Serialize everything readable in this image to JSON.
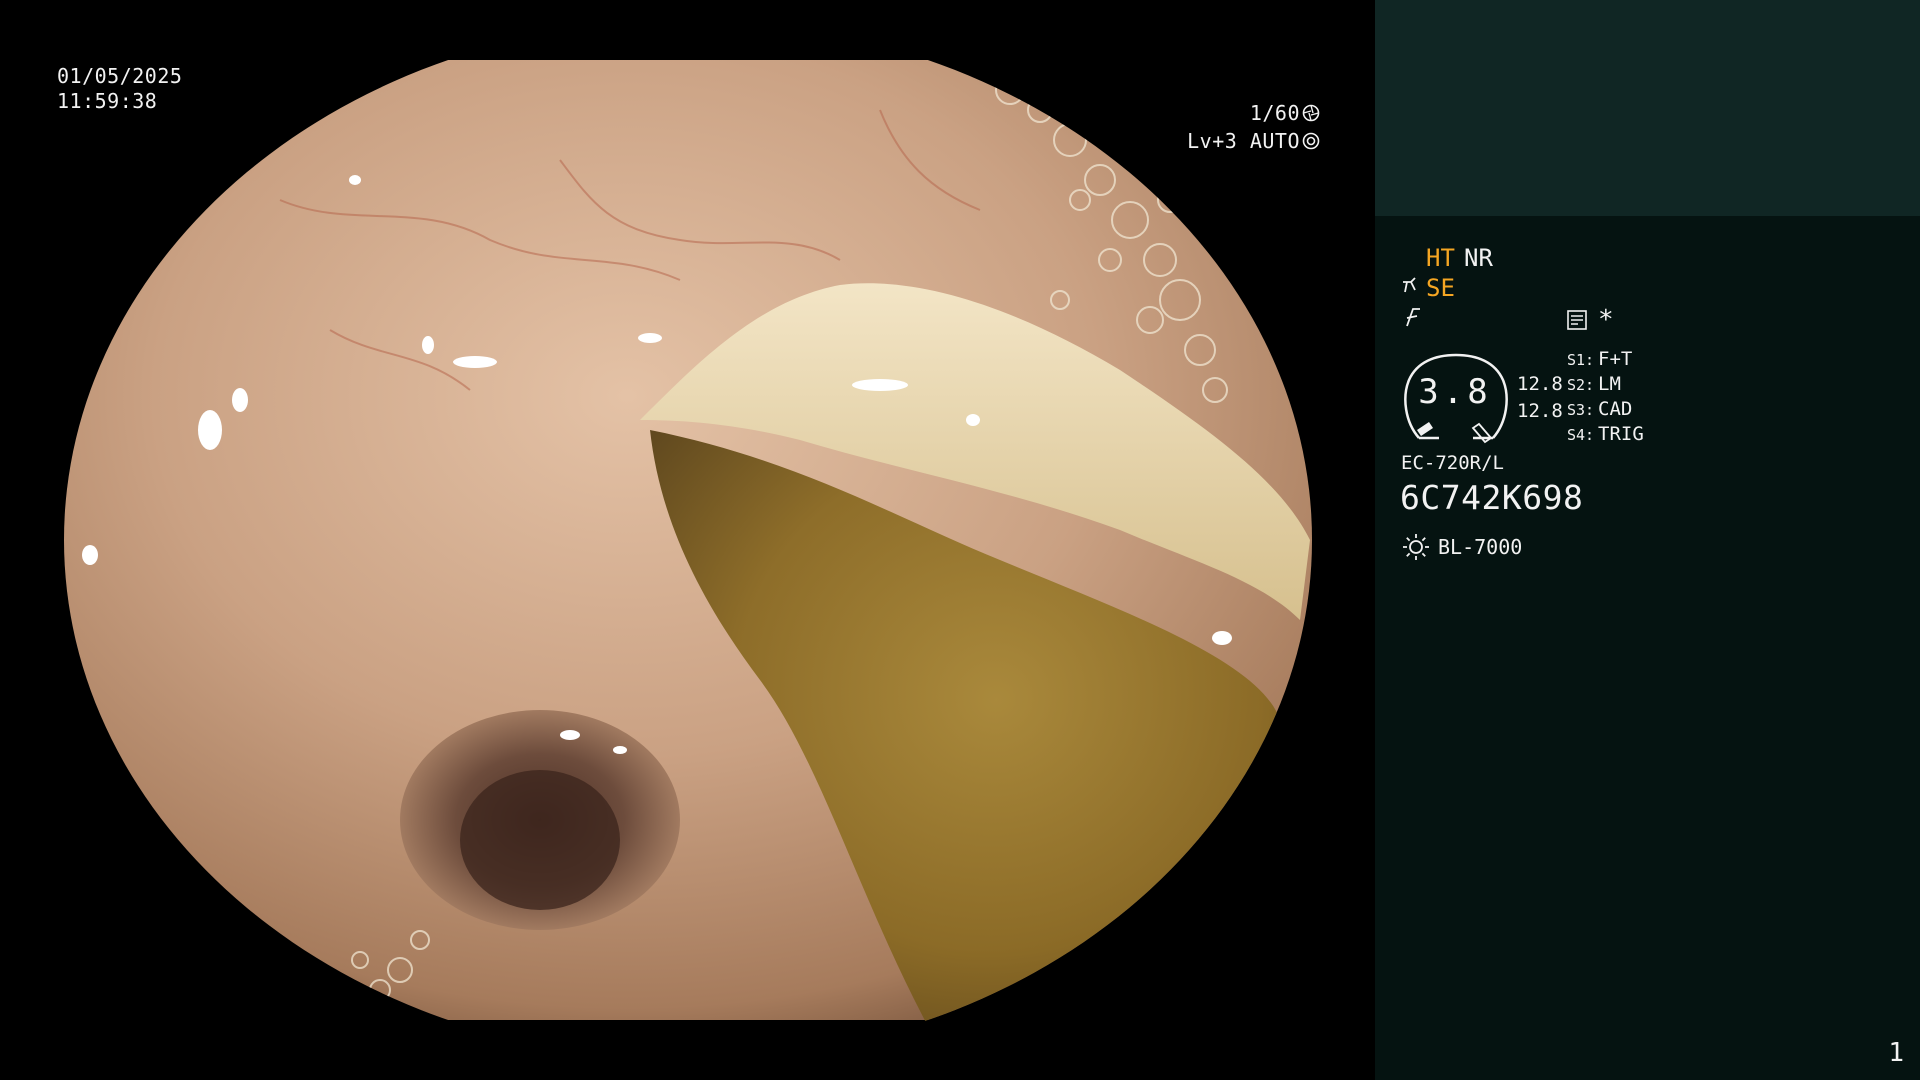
{
  "display": {
    "date": "01/05/2025",
    "time": "11:59:38",
    "shutter": "1/60",
    "shutter_icon": "aperture-icon",
    "brightness": "Lv+3 AUTO",
    "brightness_icon": "auto-exposure-icon"
  },
  "panel": {
    "ht_label": "HT",
    "nr_label": "NR",
    "se_label": "SE",
    "se_icon": "structure-enhance-icon",
    "freeze_icon": "freeze-icon",
    "memo_icon": "memo-icon",
    "asterisk": "*",
    "gauge_value": "3.8",
    "scale_top": "12.8",
    "scale_bottom": "12.8",
    "slots": [
      {
        "label": "S1:",
        "value": "F+T"
      },
      {
        "label": "S2:",
        "value": "LM"
      },
      {
        "label": "S3:",
        "value": "CAD"
      },
      {
        "label": "S4:",
        "value": "TRIG"
      }
    ],
    "scope_model": "EC-720R/L",
    "serial": "6C742K698",
    "light_source": "BL-7000",
    "light_icon": "light-source-icon",
    "page_number": "1"
  },
  "colors": {
    "panel_background": "#051311",
    "panel_header": "#102624",
    "highlight_orange": "#f5a623",
    "text_white": "#f2f2f2"
  }
}
